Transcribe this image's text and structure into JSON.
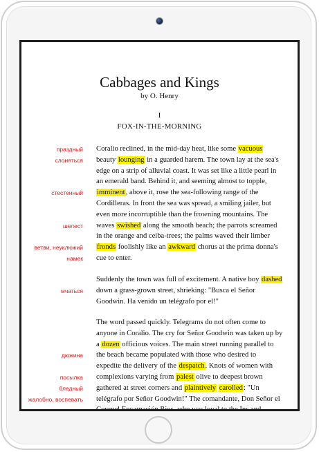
{
  "book": {
    "title": "Cabbages and Kings",
    "author": "by O. Henry",
    "chapter_number": "I",
    "chapter_title": "FOX-IN-THE-MORNING"
  },
  "paragraphs": [
    {
      "lines": [
        [
          {
            "t": "Coralio reclined, in the mid-day heat, like some "
          },
          {
            "t": "vacuous",
            "hl": true
          }
        ],
        [
          {
            "t": "beauty "
          },
          {
            "t": "lounging",
            "hl": true
          },
          {
            "t": " in a guarded harem. The town lay at the sea's"
          }
        ],
        [
          {
            "t": "edge on a strip of alluvial coast. It was set like a little pearl in"
          }
        ],
        [
          {
            "t": "an emerald band. Behind it, and seeming almost to topple,"
          }
        ],
        [
          {
            "t": "imminent",
            "hl": true
          },
          {
            "t": ", above it, rose the sea-following range of the"
          }
        ],
        [
          {
            "t": "Cordilleras. In front the sea was spread, a smiling jailer, but"
          }
        ],
        [
          {
            "t": "even more incorruptible than the frowning mountains. The"
          }
        ],
        [
          {
            "t": "waves "
          },
          {
            "t": "swished",
            "hl": true
          },
          {
            "t": " along the smooth beach; the parrots screamed"
          }
        ],
        [
          {
            "t": "in the orange and ceiba-trees; the palms waved their limber"
          }
        ],
        [
          {
            "t": "fronds",
            "hl": true
          },
          {
            "t": " foolishly like an "
          },
          {
            "t": "awkward",
            "hl": true
          },
          {
            "t": " chorus at the prima donna's"
          }
        ],
        [
          {
            "t": "cue to enter."
          }
        ]
      ]
    },
    {
      "lines": [
        [
          {
            "t": "Suddenly the town was full of excitement. A native boy "
          },
          {
            "t": "dashed",
            "hl": true
          }
        ],
        [
          {
            "t": "down a grass-grown street, shrieking: \"Busca el Señor"
          }
        ],
        [
          {
            "t": "Goodwin. Ha venido un telégrafo por el!\""
          }
        ]
      ]
    },
    {
      "lines": [
        [
          {
            "t": "The word passed quickly. Telegrams do not often come to"
          }
        ],
        [
          {
            "t": "anyone in Coralio. The cry for Señor Goodwin was taken up by"
          }
        ],
        [
          {
            "t": "a "
          },
          {
            "t": "dozen",
            "hl": true
          },
          {
            "t": " officious voices. The main street running parallel to"
          }
        ],
        [
          {
            "t": "the beach became populated with those who desired to"
          }
        ],
        [
          {
            "t": "expedite the delivery of the "
          },
          {
            "t": "despatch",
            "hl": true
          },
          {
            "t": ". Knots of women with"
          }
        ],
        [
          {
            "t": "complexions varying from "
          },
          {
            "t": "palest",
            "hl": true
          },
          {
            "t": " olive to deepest brown"
          }
        ],
        [
          {
            "t": "gathered at street corners and "
          },
          {
            "t": "plaintively",
            "hl": true
          },
          {
            "t": " "
          },
          {
            "t": "carolled",
            "hl": true
          },
          {
            "t": ": \"Un"
          }
        ],
        [
          {
            "t": "telégrafo por Señor Goodwin!\" The comandante, Don Señor el"
          }
        ],
        [
          {
            "t": "Coronel Encarnación Rios, who was loyal to the Ins and"
          }
        ]
      ]
    }
  ],
  "glosses": [
    {
      "text": "праздный",
      "line": 0
    },
    {
      "text": "слоняться",
      "line": 1
    },
    {
      "text": "стестенный",
      "line": 4
    },
    {
      "text": "шелест",
      "line": 7
    },
    {
      "text": "ветви, неуклюжий",
      "line": 9
    },
    {
      "text": "намек",
      "line": 10
    },
    {
      "text": "мчаться",
      "line": 12
    },
    {
      "text": "дюжина",
      "line": 17
    },
    {
      "text": "посылка",
      "line": 19
    },
    {
      "text": "бледный",
      "line": 20
    },
    {
      "text": "жалобно, воспевать",
      "line": 21
    }
  ],
  "colors": {
    "highlight": "#fff200",
    "gloss": "#d81b1b",
    "text": "#111111",
    "bezel": "#1d1d1d"
  }
}
